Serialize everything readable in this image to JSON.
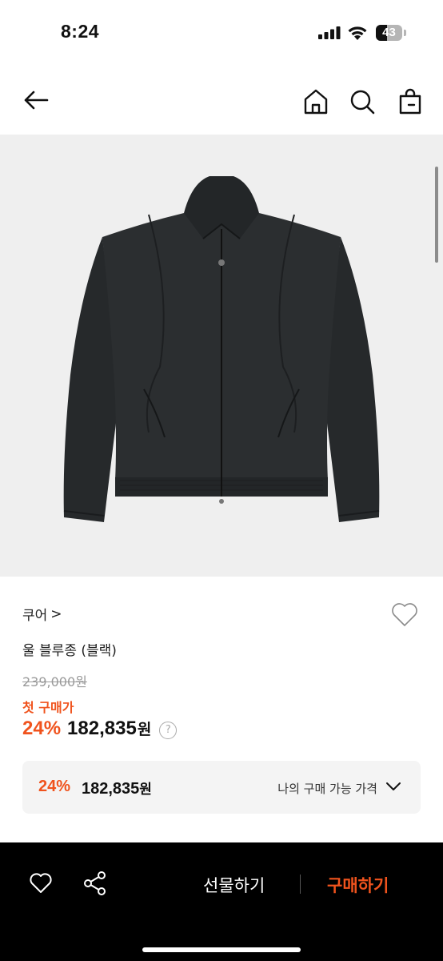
{
  "status": {
    "time": "8:24",
    "battery": "43",
    "battery_level": 0.43
  },
  "nav": {
    "icons": [
      "back-arrow-icon",
      "home-icon",
      "search-icon",
      "shopping-bag-icon"
    ]
  },
  "product": {
    "brand": "쿠어",
    "brand_chevron": ">",
    "name": "울 블루종 (블랙)",
    "original_price": "239,000원",
    "first_purchase_label": "첫 구매가",
    "discount": "24%",
    "sale_price": "182,835",
    "currency": "원",
    "help_icon": "?"
  },
  "price_box": {
    "discount": "24%",
    "price": "182,835",
    "currency": "원",
    "label": "나의 구매 가능 가격"
  },
  "bottom_bar": {
    "gift_label": "선물하기",
    "buy_label": "구매하기"
  },
  "colors": {
    "accent": "#f0531d",
    "bottom_bar": "#000000",
    "image_bg": "#efefef"
  }
}
